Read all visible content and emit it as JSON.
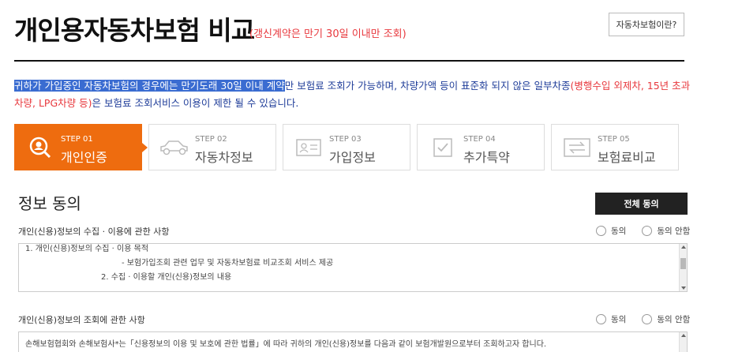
{
  "header": {
    "title": "개인용자동차보험 비교",
    "subtitle": "(갱신계약은 만기 30일 이내만 조회)",
    "whatis_button": "자동차보험이란?"
  },
  "notice": {
    "highlighted": "귀하가 가입중인 자동차보험의 경우에는 만기도래 30일 이내 계약",
    "text1": "만 보험료 조회가 가능하며, 차량가액 등이 표준화 되지 않은 일부차종",
    "red_part": "(병행수입 외제차, 15년 초과차량, LPG차량 등)",
    "text2": "은 보험료 조회서비스 이용이 제한 될 수 있습니다."
  },
  "steps": [
    {
      "num": "STEP 01",
      "name": "개인인증",
      "icon": "search-person-icon",
      "active": true
    },
    {
      "num": "STEP 02",
      "name": "자동차정보",
      "icon": "car-icon",
      "active": false
    },
    {
      "num": "STEP 03",
      "name": "가입정보",
      "icon": "id-card-icon",
      "active": false
    },
    {
      "num": "STEP 04",
      "name": "추가특약",
      "icon": "checkbox-icon",
      "active": false
    },
    {
      "num": "STEP 05",
      "name": "보험료비교",
      "icon": "compare-arrows-icon",
      "active": false
    }
  ],
  "consent": {
    "section_title": "정보 동의",
    "agree_all_button": "전체 동의",
    "agree_label": "동의",
    "disagree_label": "동의 안함",
    "items": [
      {
        "label": "개인(신용)정보의 수집 · 이용에 관한 사항",
        "lines": [
          "1. 개인(신용)정보의 수집 · 이용 목적",
          "- 보험가입조회 관련 업무 및 자동차보험료 비교조회 서비스 제공",
          "2. 수집 · 이용할 개인(신용)정보의 내용"
        ]
      },
      {
        "label": "개인(신용)정보의 조회에 관한 사항",
        "lines": [
          "손해보험협회와 손해보험사*는「신용정보의 이용 및 보호에 관한 법률」에 따라 귀하의 개인(신용)정보를 다음과 같이 보험개발원으로부터 조회하고자 합니다."
        ]
      }
    ]
  }
}
